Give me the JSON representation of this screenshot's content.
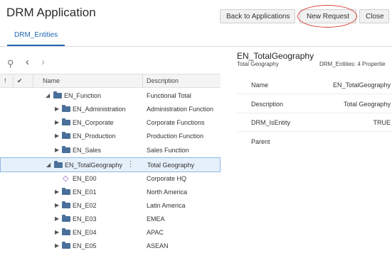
{
  "header": {
    "title": "DRM Application",
    "buttons": {
      "back": "Back to Applications",
      "new_request": "New Request",
      "close": "Close"
    }
  },
  "tabs": [
    {
      "label": "DRM_Entities",
      "active": true
    }
  ],
  "toolbar": {
    "icons": [
      "search-icon",
      "chevron-left-icon",
      "chevron-right-icon"
    ]
  },
  "grid": {
    "columns": {
      "flag": "!",
      "check": "✔",
      "name": "Name",
      "description": "Description"
    },
    "rows": [
      {
        "name": "EN_Function",
        "description": "Functional Total",
        "expanded": true
      },
      {
        "name": "EN_Administration",
        "description": "Administration Function",
        "expanded": false
      },
      {
        "name": "EN_Corporate",
        "description": "Corporate Functions",
        "expanded": false
      },
      {
        "name": "EN_Production",
        "description": "Production Function",
        "expanded": false
      },
      {
        "name": "EN_Sales",
        "description": "Sales Function",
        "expanded": false
      },
      {
        "name": "EN_TotalGeography",
        "description": "Total Geography",
        "expanded": true,
        "selected": true
      },
      {
        "name": "EN_E00",
        "description": "Corporate HQ",
        "leaf": true
      },
      {
        "name": "EN_E01",
        "description": "North America",
        "expanded": false
      },
      {
        "name": "EN_E02",
        "description": "Latin America",
        "expanded": false
      },
      {
        "name": "EN_E03",
        "description": "EMEA",
        "expanded": false
      },
      {
        "name": "EN_E04",
        "description": "APAC",
        "expanded": false
      },
      {
        "name": "EN_E05",
        "description": "ASEAN",
        "expanded": false
      }
    ]
  },
  "detail": {
    "title": "EN_TotalGeography",
    "subtitle": "Total Geography",
    "properties_label": "DRM_Entities: 4 Propertie",
    "properties": [
      {
        "label": "Name",
        "value": "EN_TotalGeography"
      },
      {
        "label": "Description",
        "value": "Total Geography"
      },
      {
        "label": "DRM_IsEntity",
        "value": "TRUE"
      },
      {
        "label": "Parent",
        "value": ""
      }
    ]
  },
  "colors": {
    "accent": "#1f67b1",
    "highlight_oval": "#d64541",
    "folder": "#4a6f9a",
    "leaf": "#8a56c2",
    "selected_row": "#e6f0fa"
  }
}
